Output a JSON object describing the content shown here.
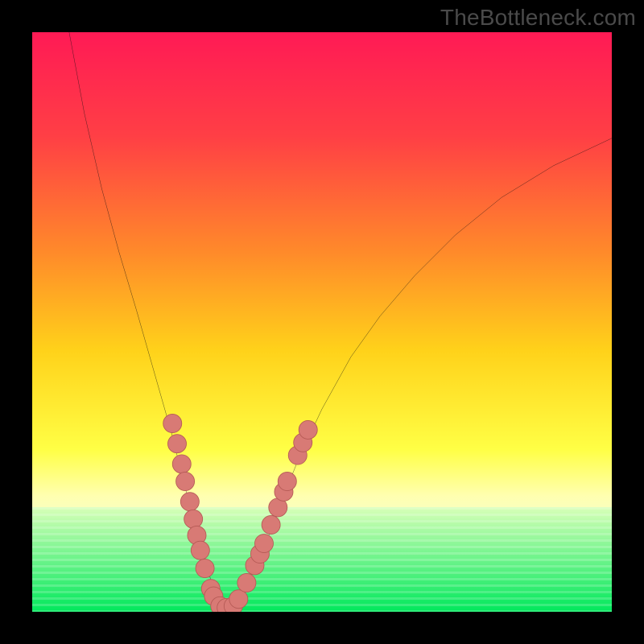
{
  "watermark": "TheBottleneck.com",
  "colors": {
    "gradient_stops": [
      {
        "pct": 0,
        "color": "#ff1a55"
      },
      {
        "pct": 18,
        "color": "#ff3f45"
      },
      {
        "pct": 38,
        "color": "#ff8a2a"
      },
      {
        "pct": 55,
        "color": "#ffd21a"
      },
      {
        "pct": 72,
        "color": "#ffff45"
      },
      {
        "pct": 80,
        "color": "#ffffb0"
      },
      {
        "pct": 86,
        "color": "#f0ffd0"
      },
      {
        "pct": 100,
        "color": "#00e85c"
      }
    ],
    "green_strip": {
      "top_color": "#d8ffb8",
      "bottom_color": "#00e85c",
      "top_pct": 82,
      "height_pct": 18
    },
    "curve_stroke": "#111111",
    "dot_fill": "#d87a75",
    "dot_stroke": "#b55a55"
  },
  "chart_data": {
    "type": "line",
    "title": "",
    "xlabel": "",
    "ylabel": "",
    "xlim": [
      0,
      100
    ],
    "ylim": [
      0,
      100
    ],
    "note": "V-shaped curve on gradient background; y increases downward in screen space. Values below are screen-space percentages (0..100) of the plot area.",
    "series": [
      {
        "name": "curve",
        "x": [
          6,
          9,
          12,
          15,
          18,
          20,
          22,
          24,
          25.5,
          27,
          28.5,
          30,
          31.5,
          33,
          34.5,
          36.5,
          40,
          43,
          46,
          50,
          55,
          60,
          66,
          73,
          81,
          90,
          100
        ],
        "y": [
          -2,
          14,
          27,
          38,
          48,
          55,
          62,
          69,
          75,
          81,
          87,
          92,
          96.5,
          99.2,
          99.2,
          96.5,
          89,
          81,
          73.5,
          65,
          56,
          49,
          42,
          35,
          28.5,
          23,
          18.3
        ]
      }
    ],
    "dots": [
      {
        "x": 24.2,
        "y": 67.5
      },
      {
        "x": 25.0,
        "y": 71.0
      },
      {
        "x": 25.8,
        "y": 74.5
      },
      {
        "x": 26.4,
        "y": 77.5
      },
      {
        "x": 27.2,
        "y": 81.0
      },
      {
        "x": 27.8,
        "y": 84.0
      },
      {
        "x": 28.4,
        "y": 86.8
      },
      {
        "x": 29.0,
        "y": 89.4
      },
      {
        "x": 29.8,
        "y": 92.5
      },
      {
        "x": 30.8,
        "y": 96.0
      },
      {
        "x": 31.3,
        "y": 97.3
      },
      {
        "x": 32.4,
        "y": 99.0
      },
      {
        "x": 33.5,
        "y": 99.3
      },
      {
        "x": 34.7,
        "y": 99.0
      },
      {
        "x": 35.6,
        "y": 97.8
      },
      {
        "x": 37.0,
        "y": 95.0
      },
      {
        "x": 38.4,
        "y": 92.0
      },
      {
        "x": 39.3,
        "y": 90.0
      },
      {
        "x": 40.0,
        "y": 88.2
      },
      {
        "x": 41.2,
        "y": 85.0
      },
      {
        "x": 42.4,
        "y": 82.0
      },
      {
        "x": 43.4,
        "y": 79.3
      },
      {
        "x": 44.0,
        "y": 77.5
      },
      {
        "x": 45.8,
        "y": 73.0
      },
      {
        "x": 46.7,
        "y": 70.8
      },
      {
        "x": 47.6,
        "y": 68.6
      }
    ],
    "dot_radius_pct": 1.6
  }
}
